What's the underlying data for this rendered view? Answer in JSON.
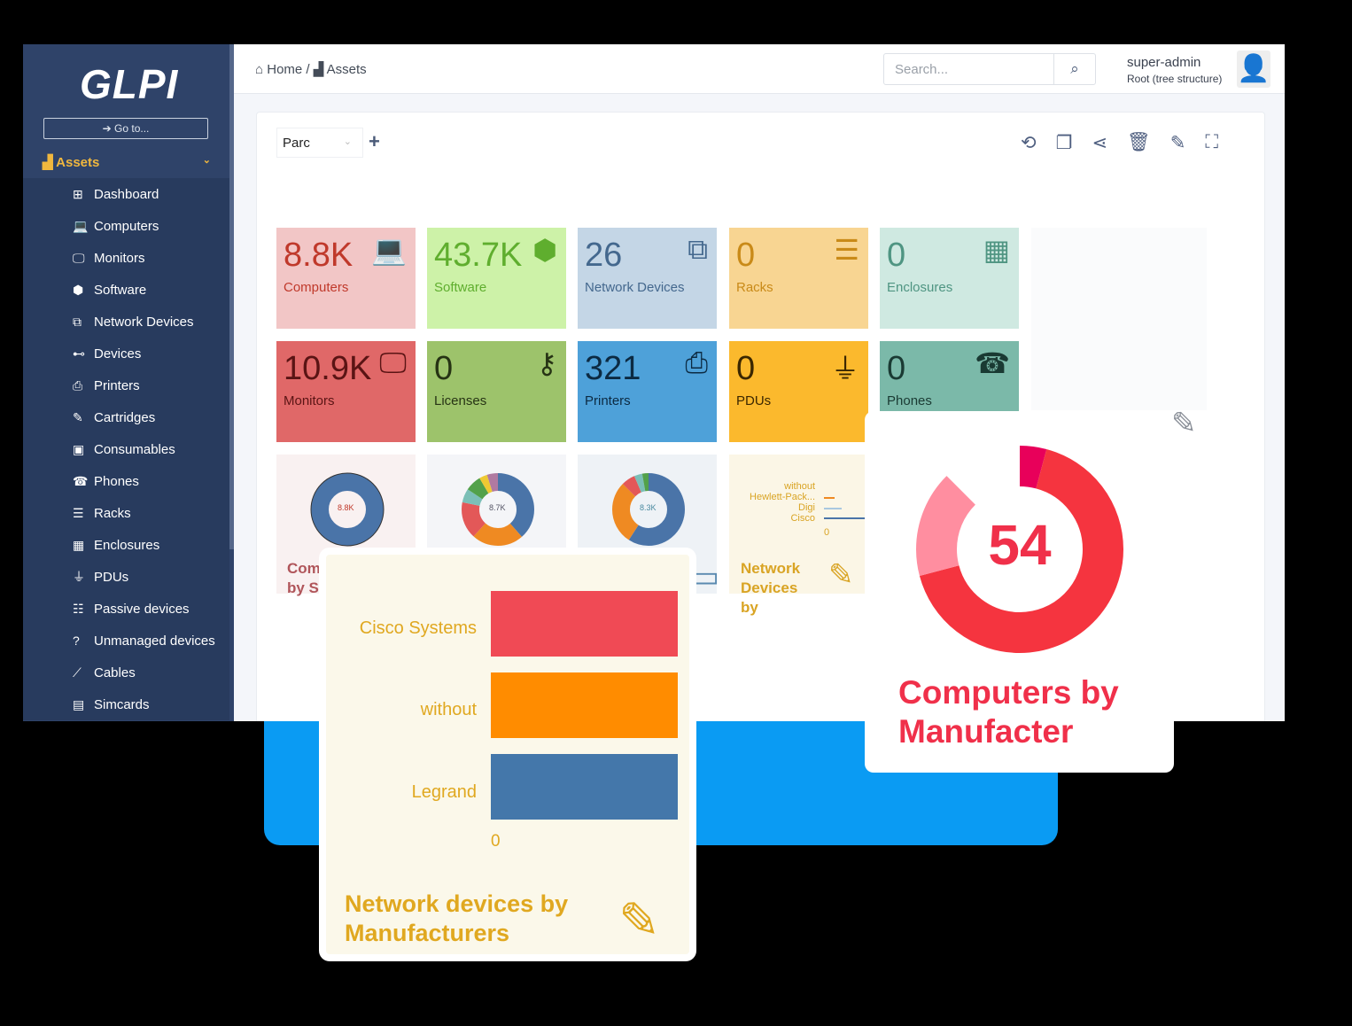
{
  "app": {
    "logo": "GLPI",
    "goto": "Go to..."
  },
  "sidebar": {
    "section": "Assets",
    "items": [
      {
        "label": "Dashboard",
        "icon": "⊞"
      },
      {
        "label": "Computers",
        "icon": "💻"
      },
      {
        "label": "Monitors",
        "icon": "🖵"
      },
      {
        "label": "Software",
        "icon": "⬢"
      },
      {
        "label": "Network Devices",
        "icon": "⧉"
      },
      {
        "label": "Devices",
        "icon": "⊷"
      },
      {
        "label": "Printers",
        "icon": "⎙"
      },
      {
        "label": "Cartridges",
        "icon": "✎"
      },
      {
        "label": "Consumables",
        "icon": "▣"
      },
      {
        "label": "Phones",
        "icon": "☎"
      },
      {
        "label": "Racks",
        "icon": "☰"
      },
      {
        "label": "Enclosures",
        "icon": "▦"
      },
      {
        "label": "PDUs",
        "icon": "⏚"
      },
      {
        "label": "Passive devices",
        "icon": "☷"
      },
      {
        "label": "Unmanaged devices",
        "icon": "?"
      },
      {
        "label": "Cables",
        "icon": "⟋"
      },
      {
        "label": "Simcards",
        "icon": "▤"
      }
    ]
  },
  "header": {
    "breadcrumb": [
      "Home",
      "Assets"
    ],
    "search_placeholder": "Search...",
    "user": "super-admin",
    "entity": "Root (tree structure)"
  },
  "dashboard": {
    "selected": "Parc",
    "tiles": [
      {
        "value": "8.8K",
        "label": "Computers",
        "icon": "💻",
        "bg": "#f2c6c6",
        "fg": "#c0392b"
      },
      {
        "value": "43.7K",
        "label": "Software",
        "icon": "⬢",
        "bg": "#cdf2a8",
        "fg": "#5fae2e"
      },
      {
        "value": "26",
        "label": "Network Devices",
        "icon": "⧉",
        "bg": "#c4d6e6",
        "fg": "#44688e"
      },
      {
        "value": "0",
        "label": "Racks",
        "icon": "☰",
        "bg": "#f8d592",
        "fg": "#c98a18"
      },
      {
        "value": "0",
        "label": "Enclosures",
        "icon": "▦",
        "bg": "#cfe9e1",
        "fg": "#4f9582"
      },
      {
        "value": "10.9K",
        "label": "Monitors",
        "icon": "🖵",
        "bg": "#e06868",
        "fg": "#5a1414"
      },
      {
        "value": "0",
        "label": "Licenses",
        "icon": "⚷",
        "bg": "#9dc36b",
        "fg": "#263314"
      },
      {
        "value": "321",
        "label": "Printers",
        "icon": "⎙",
        "bg": "#4ea1d9",
        "fg": "#0c2a42"
      },
      {
        "value": "0",
        "label": "PDUs",
        "icon": "⏚",
        "bg": "#fbb92d",
        "fg": "#3b2700"
      },
      {
        "value": "0",
        "label": "Phones",
        "icon": "☎",
        "bg": "#7bb9a9",
        "fg": "#1a3a33"
      }
    ],
    "mini": [
      {
        "center": "8.8K",
        "title": "Com\nby S"
      },
      {
        "center": "8.7K"
      },
      {
        "center": "8.3K"
      }
    ],
    "net_mini": {
      "labels": [
        "without",
        "Hewlett-Pack...",
        "Digi",
        "Cisco"
      ],
      "zero": "0",
      "title": "Network Devices by"
    }
  },
  "chart_data": [
    {
      "type": "bar",
      "title": "Network devices by Manufacturers",
      "categories": [
        "Cisco Systems",
        "without",
        "Legrand"
      ],
      "values": [
        1,
        1,
        1
      ],
      "colors": [
        "#f04a55",
        "#ff8c00",
        "#4477aa"
      ],
      "xtick": "0"
    },
    {
      "type": "pie",
      "title": "Computers by Manufacter",
      "center_value": "54",
      "slices": [
        {
          "value": 36,
          "color": "#f5343f"
        },
        {
          "value": 9,
          "color": "#e8005a"
        },
        {
          "value": 9,
          "color": "#ff8ea0"
        }
      ]
    }
  ]
}
